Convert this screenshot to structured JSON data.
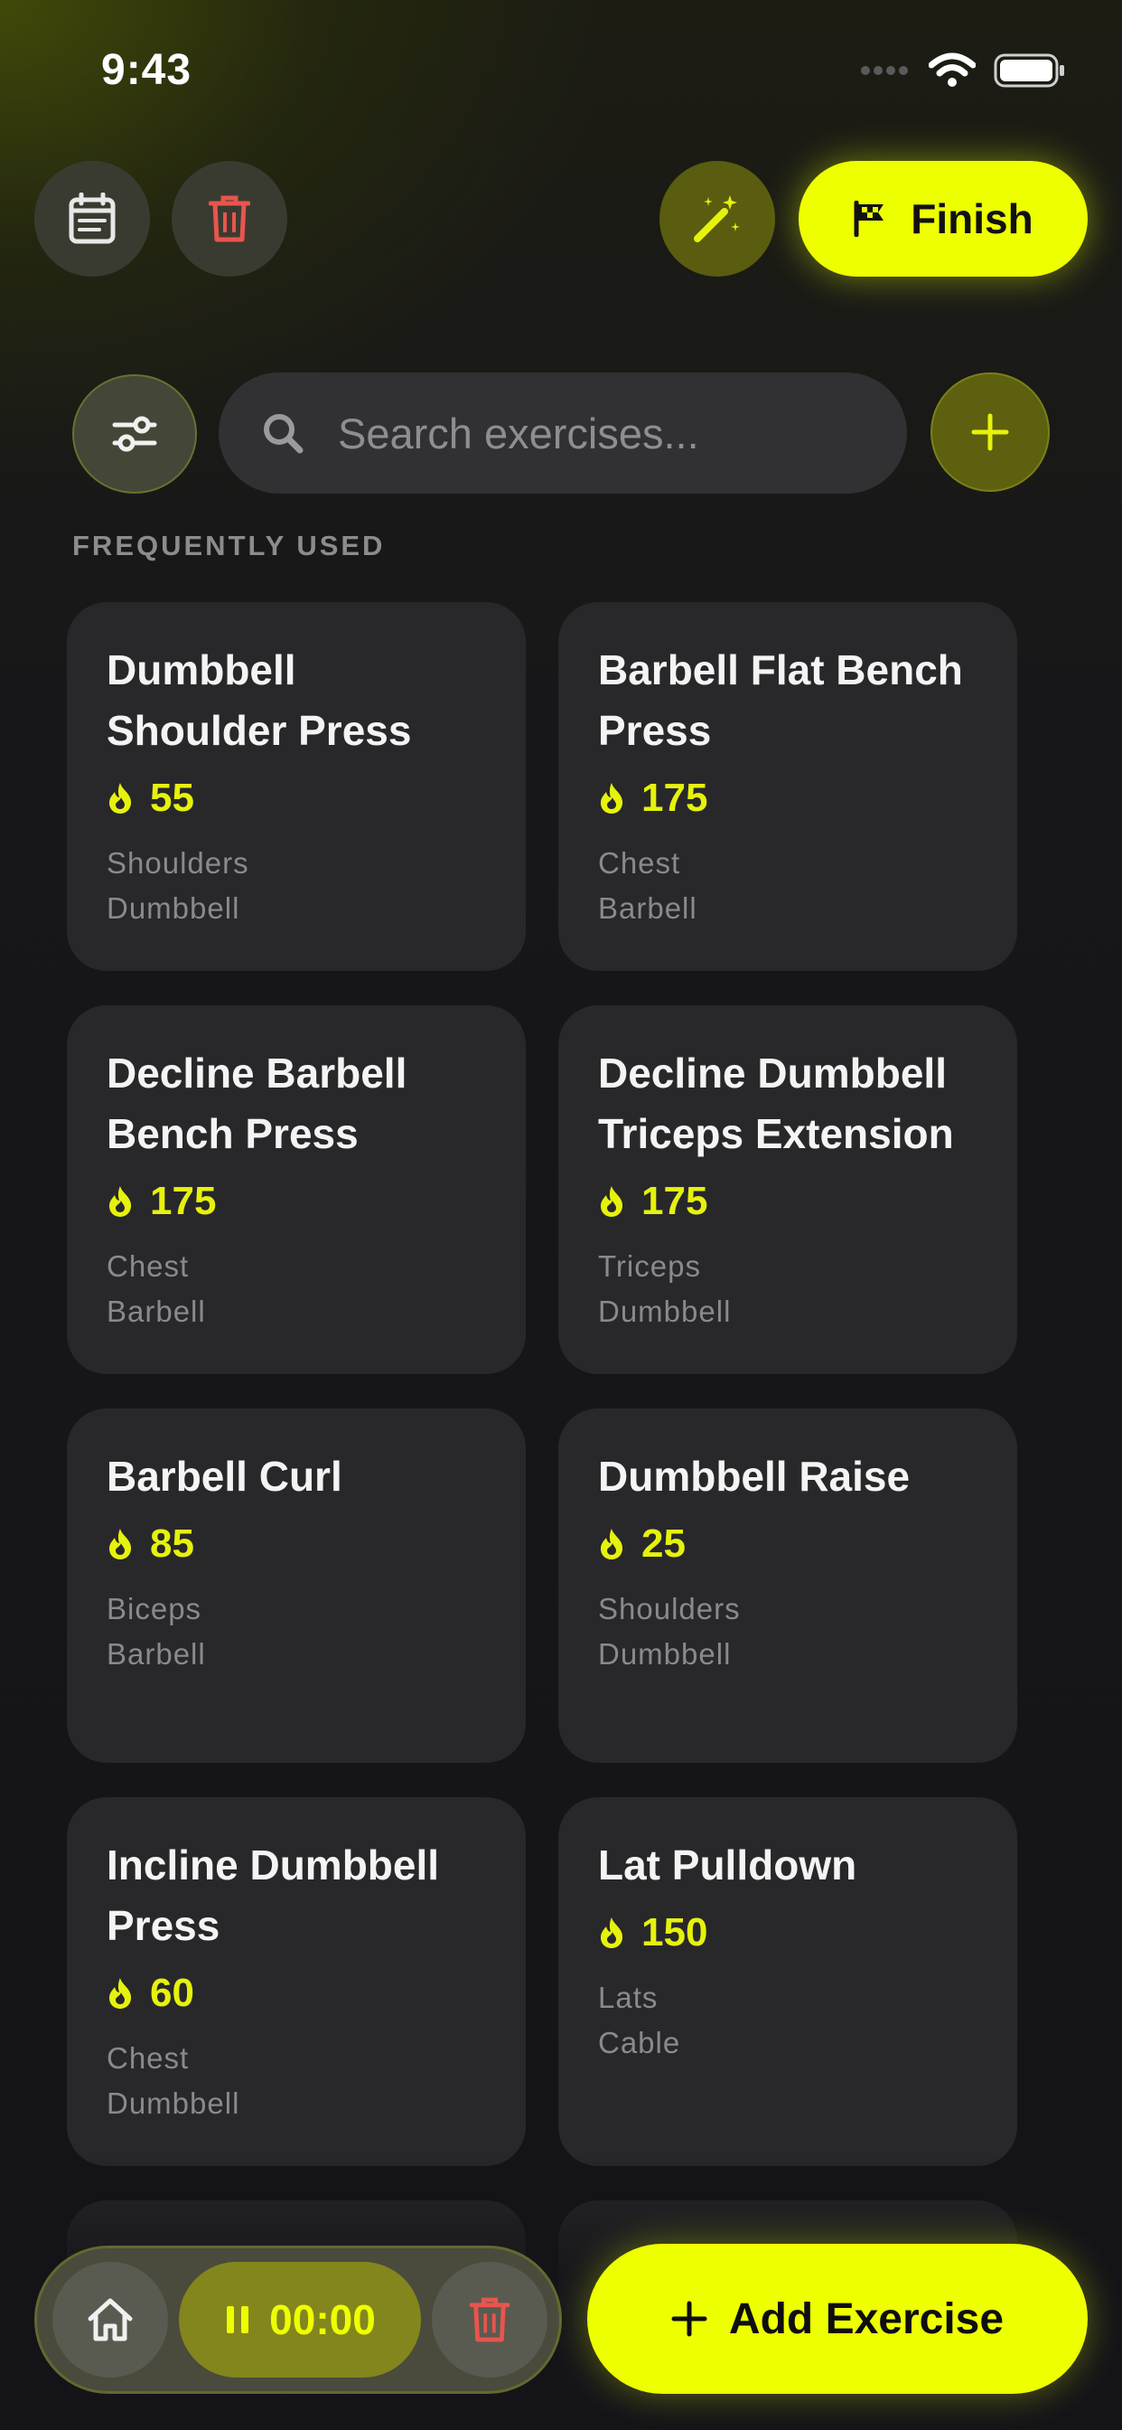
{
  "status_bar": {
    "time": "9:43"
  },
  "toolbar": {
    "finish_label": "Finish"
  },
  "search": {
    "placeholder": "Search exercises..."
  },
  "section": {
    "label": "FREQUENTLY USED"
  },
  "exercises": [
    {
      "title_line1": "Dumbbell",
      "title_line2": "Shoulder Press",
      "value": "55",
      "muscle": "Shoulders",
      "equipment": "Dumbbell"
    },
    {
      "title_line1": "Barbell Flat Bench",
      "title_line2": "Press",
      "value": "175",
      "muscle": "Chest",
      "equipment": "Barbell"
    },
    {
      "title_line1": "Decline Barbell",
      "title_line2": "Bench Press",
      "value": "175",
      "muscle": "Chest",
      "equipment": "Barbell"
    },
    {
      "title_line1": "Decline Dumbbell",
      "title_line2": "Triceps Extension",
      "value": "175",
      "muscle": "Triceps",
      "equipment": "Dumbbell"
    },
    {
      "title_line1": "Barbell Curl",
      "title_line2": "",
      "value": "85",
      "muscle": "Biceps",
      "equipment": "Barbell"
    },
    {
      "title_line1": "Dumbbell Raise",
      "title_line2": "",
      "value": "25",
      "muscle": "Shoulders",
      "equipment": "Dumbbell"
    },
    {
      "title_line1": "Incline Dumbbell",
      "title_line2": "Press",
      "value": "60",
      "muscle": "Chest",
      "equipment": "Dumbbell"
    },
    {
      "title_line1": "Lat Pulldown",
      "title_line2": "",
      "value": "150",
      "muscle": "Lats",
      "equipment": "Cable"
    }
  ],
  "bottom_bar": {
    "timer": "00:00",
    "add_exercise_label": "Add Exercise"
  },
  "colors": {
    "accent": "#eeff00",
    "danger": "#e8554d",
    "card": "#28282b"
  },
  "icons": [
    "calendar-list-icon",
    "trash-icon",
    "magic-wand-icon",
    "flag-icon",
    "sliders-icon",
    "search-icon",
    "plus-icon",
    "flame-icon",
    "home-icon",
    "pause-icon"
  ]
}
